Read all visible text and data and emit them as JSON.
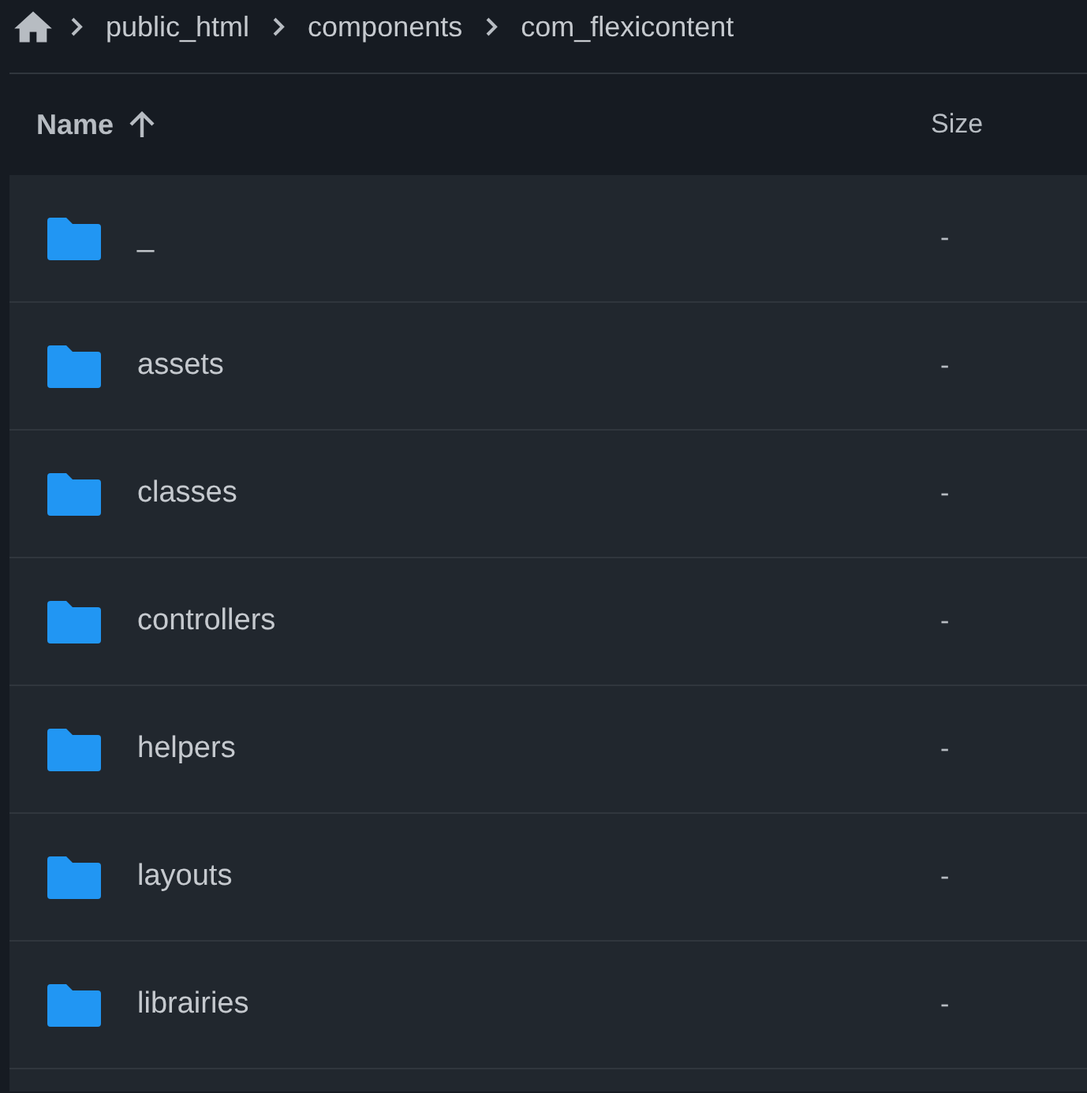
{
  "breadcrumb": [
    "public_html",
    "components",
    "com_flexicontent"
  ],
  "table": {
    "columns": [
      {
        "label": "Name",
        "sort_ascending": true
      },
      {
        "label": "Size"
      }
    ],
    "rows": [
      {
        "name": "_",
        "size": "-"
      },
      {
        "name": "assets",
        "size": "-"
      },
      {
        "name": "classes",
        "size": "-"
      },
      {
        "name": "controllers",
        "size": "-"
      },
      {
        "name": "helpers",
        "size": "-"
      },
      {
        "name": "layouts",
        "size": "-"
      },
      {
        "name": "librairies",
        "size": "-"
      }
    ]
  }
}
